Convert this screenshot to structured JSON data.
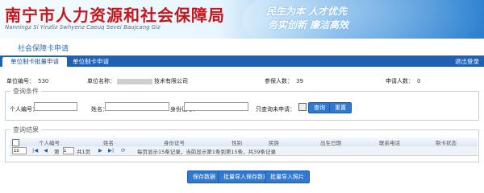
{
  "header": {
    "org_title": "南宁市人力资源和社会保障局",
    "org_subtitle": "Nanningz Si Yinzliz Swhyenz Caeuq Sevei Baujcang Giz",
    "slogan_line1": "民生为本 人才优先",
    "slogan_line2": "务实创新 廉洁高效"
  },
  "page_title": "社会保障卡申请",
  "tabs": [
    {
      "label": "单位制卡批量申请",
      "active": true
    },
    {
      "label": "单位制卡申请",
      "active": false
    }
  ],
  "logout_label": "退出登录",
  "info": {
    "unit_no_label": "单位编号：",
    "unit_no_value": "530",
    "unit_name_label": "单位名称：",
    "unit_name_value": "技术有限公司",
    "insured_count_label": "参保人数：",
    "insured_count_value": "39",
    "applied_count_label": "申请人数：",
    "applied_count_value": "0"
  },
  "query": {
    "legend": "查询条件",
    "person_no_label": "个人编号：",
    "name_label": "姓名：",
    "id_no_label": "身份证号：",
    "only_unapplied_label": "只查询未申请：",
    "query_button": "查询",
    "reset_button": "重置"
  },
  "results": {
    "legend": "查询结果",
    "columns": [
      "个人编号",
      "姓名",
      "身份证号",
      "性别",
      "民族",
      "出生日期",
      "联系电话",
      "制卡状态"
    ]
  },
  "pager": {
    "page_size": "15",
    "page_label": "第",
    "current_page": "1",
    "total_pages_text": "共1页",
    "status_text": "每页显示15条记录，当前显示第1条到第15条，共39条记录"
  },
  "actions": {
    "save_button": "保存数据",
    "batch_save_button": "批量导入保存数据",
    "batch_import_button": "批量导入照片"
  },
  "colors": {
    "title_red": "#c8161d",
    "tab_blue": "#1f60b3",
    "button_blue": "#2f79d3"
  }
}
